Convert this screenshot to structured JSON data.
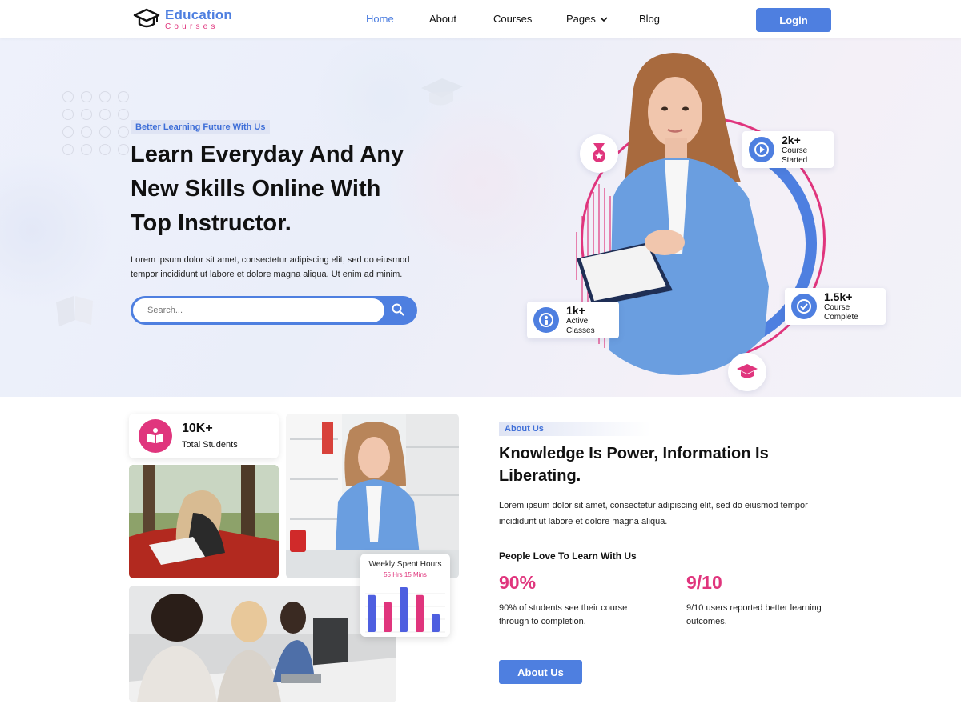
{
  "brand": {
    "name": "Education",
    "subtitle": "Courses",
    "primary_color": "#4e7fe0",
    "accent_color": "#e0357d",
    "icon": "graduation-cap-icon"
  },
  "nav": {
    "items": [
      {
        "label": "Home",
        "active": true
      },
      {
        "label": "About",
        "active": false
      },
      {
        "label": "Courses",
        "active": false
      },
      {
        "label": "Pages",
        "active": false,
        "has_dropdown": true
      },
      {
        "label": "Blog",
        "active": false
      }
    ],
    "login_label": "Login"
  },
  "hero": {
    "tagline": "Better Learning Future With Us",
    "title_lines": [
      "Learn Everyday And Any",
      "New Skills Online With",
      "Top Instructor."
    ],
    "description_lines": [
      "Lorem ipsum dolor sit amet, consectetur adipiscing elit, sed do eiusmod",
      "tempor incididunt ut labore et dolore magna aliqua. Ut enim ad minim."
    ],
    "search_placeholder": "Search...",
    "stats": [
      {
        "value": "2k+",
        "label": "Course Started",
        "icon": "play-icon"
      },
      {
        "value": "1k+",
        "label": "Active Classes",
        "icon": "user-icon"
      },
      {
        "value": "1.5k+",
        "label": "Course Complete",
        "icon": "check-icon"
      }
    ],
    "badge_icons": [
      "medal-icon",
      "graduation-cap-icon"
    ]
  },
  "about": {
    "students": {
      "value": "10K+",
      "label": "Total Students",
      "icon": "book-reader-icon"
    },
    "weekly": {
      "title": "Weekly Spent Hours",
      "subtitle": "55 Hrs 15 Mins",
      "bars": [
        {
          "value": 0.62,
          "color": "#4e5fe0"
        },
        {
          "value": 0.5,
          "color": "#e0357d"
        },
        {
          "value": 0.75,
          "color": "#4e5fe0"
        },
        {
          "value": 0.62,
          "color": "#e0357d"
        },
        {
          "value": 0.3,
          "color": "#4e5fe0"
        }
      ]
    },
    "tag": "About Us",
    "title_lines": [
      "Knowledge Is Power, Information Is",
      "Liberating."
    ],
    "description_lines": [
      "Lorem ipsum dolor sit amet, consectetur adipiscing elit, sed do eiusmod tempor",
      "incididunt ut labore et dolore magna aliqua."
    ],
    "people_label": "People Love To Learn With Us",
    "metrics": [
      {
        "value": "90%",
        "desc_lines": [
          "90% of students see their course",
          "through to completion."
        ]
      },
      {
        "value": "9/10",
        "desc_lines": [
          "9/10 users reported better learning",
          "outcomes."
        ]
      }
    ],
    "button_label": "About Us"
  }
}
